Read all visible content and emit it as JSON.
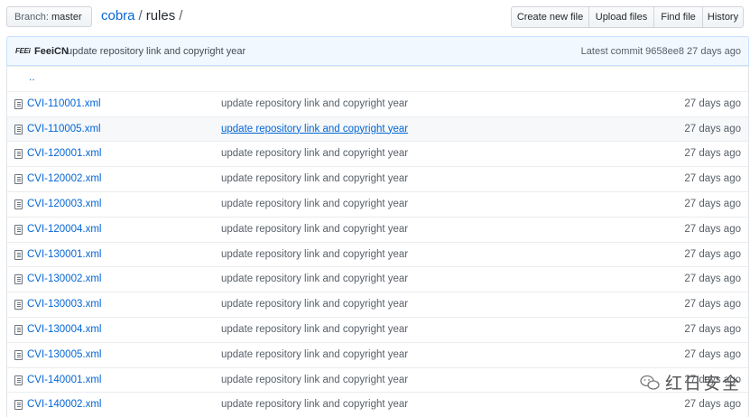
{
  "branch": {
    "label": "Branch:",
    "value": "master"
  },
  "breadcrumb": {
    "repo": "cobra",
    "sep1": "/",
    "dir": "rules",
    "sep2": "/"
  },
  "actions": [
    "Create new file",
    "Upload files",
    "Find file",
    "History"
  ],
  "commit": {
    "avatar_text": "FEEi",
    "author": "FeeiCN",
    "message": "update repository link and copyright year",
    "latest": "Latest commit 9658ee8 27 days ago"
  },
  "updir": "..",
  "files": [
    {
      "name": "CVI-110001.xml",
      "message": "update repository link and copyright year",
      "age": "27 days ago"
    },
    {
      "name": "CVI-110005.xml",
      "message": "update repository link and copyright year",
      "age": "27 days ago"
    },
    {
      "name": "CVI-120001.xml",
      "message": "update repository link and copyright year",
      "age": "27 days ago"
    },
    {
      "name": "CVI-120002.xml",
      "message": "update repository link and copyright year",
      "age": "27 days ago"
    },
    {
      "name": "CVI-120003.xml",
      "message": "update repository link and copyright year",
      "age": "27 days ago"
    },
    {
      "name": "CVI-120004.xml",
      "message": "update repository link and copyright year",
      "age": "27 days ago"
    },
    {
      "name": "CVI-130001.xml",
      "message": "update repository link and copyright year",
      "age": "27 days ago"
    },
    {
      "name": "CVI-130002.xml",
      "message": "update repository link and copyright year",
      "age": "27 days ago"
    },
    {
      "name": "CVI-130003.xml",
      "message": "update repository link and copyright year",
      "age": "27 days ago"
    },
    {
      "name": "CVI-130004.xml",
      "message": "update repository link and copyright year",
      "age": "27 days ago"
    },
    {
      "name": "CVI-130005.xml",
      "message": "update repository link and copyright year",
      "age": "27 days ago"
    },
    {
      "name": "CVI-140001.xml",
      "message": "update repository link and copyright year",
      "age": "27 days ago"
    },
    {
      "name": "CVI-140002.xml",
      "message": "update repository link and copyright year",
      "age": "27 days ago"
    }
  ],
  "watermark": {
    "text": "红日安全",
    "icon": "wechat-icon"
  }
}
